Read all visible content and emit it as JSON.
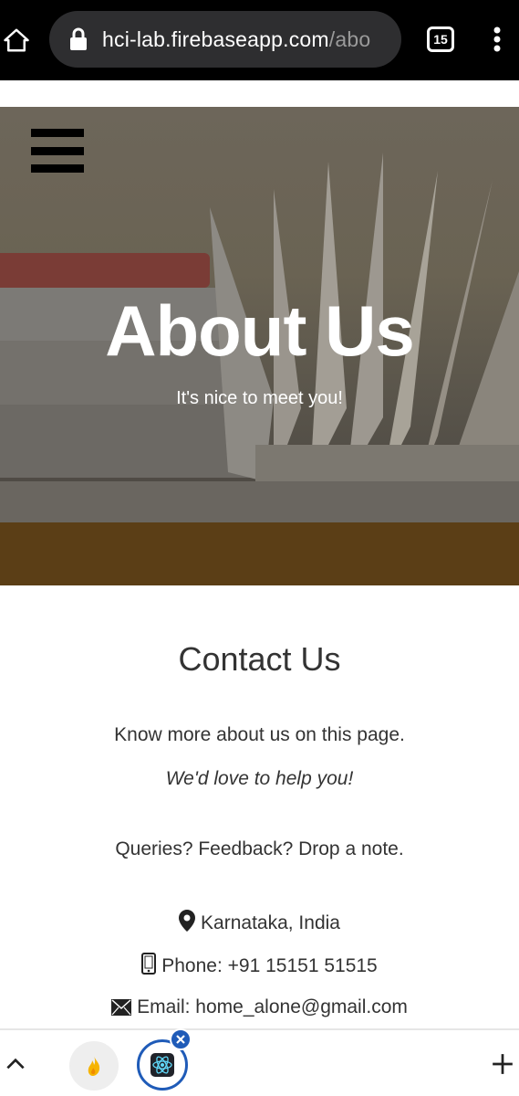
{
  "browser": {
    "url_main": "hci-lab.firebaseapp.com",
    "url_path": "/abo",
    "tab_count": "15"
  },
  "hero": {
    "title": "About Us",
    "subtitle": "It's nice to meet you!"
  },
  "contact": {
    "title": "Contact Us",
    "line1": "Know more about us on this page.",
    "line2": "We'd love to help you!",
    "line3": "Queries? Feedback? Drop a note.",
    "location": "Karnataka, India",
    "phone": "Phone: +91 15151 51515",
    "email": "Email: home_alone@gmail.com"
  },
  "colors": {
    "accent": "#1f5bb8"
  }
}
